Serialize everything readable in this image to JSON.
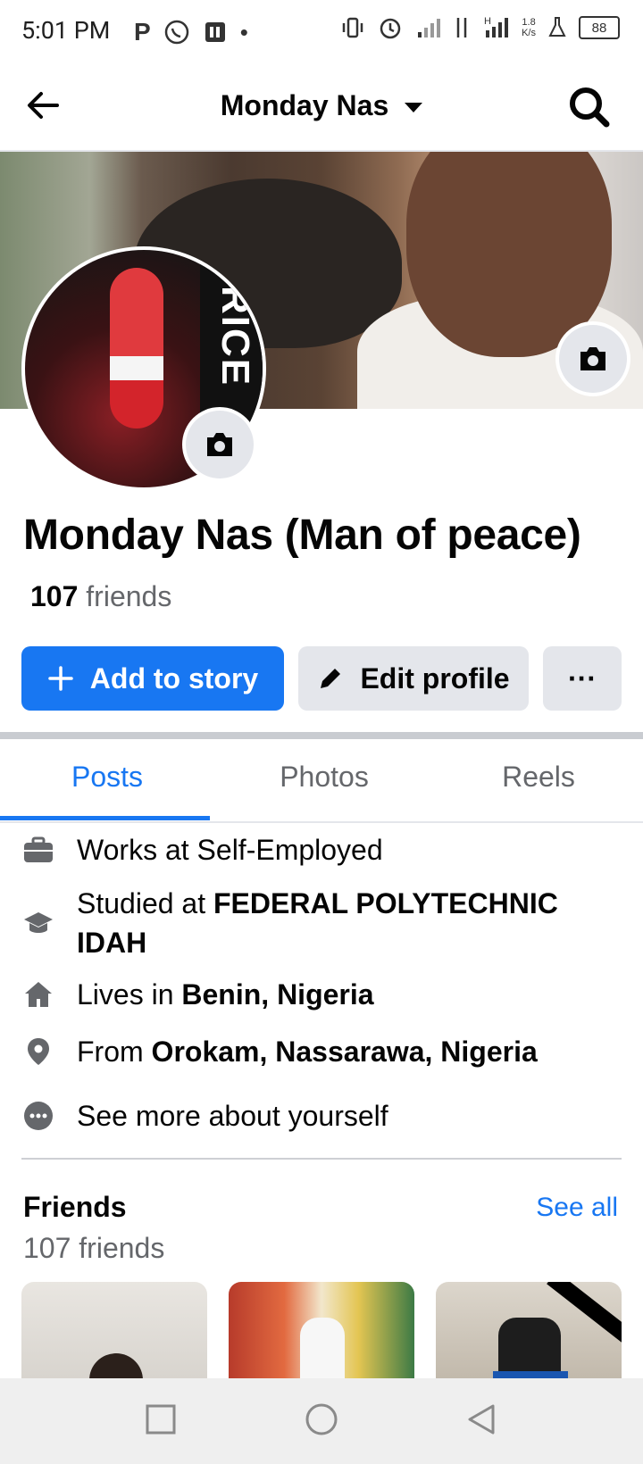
{
  "status_bar": {
    "time": "5:01 PM",
    "battery": "88",
    "net_speed": "1.8\nK/s"
  },
  "header": {
    "title": "Monday Nas"
  },
  "profile": {
    "name": "Monday Nas (Man of peace)",
    "friends_count": "107",
    "friends_word": "friends",
    "avatar_text": "RICE"
  },
  "actions": {
    "add_story": "Add to story",
    "edit_profile": "Edit profile",
    "more": "···"
  },
  "tabs": [
    "Posts",
    "Photos",
    "Reels"
  ],
  "about": {
    "work_prefix": "Works at Self-Employed",
    "study_prefix": "Studied at ",
    "study_place": "FEDERAL POLYTECHNIC IDAH",
    "lives_prefix": "Lives in ",
    "lives_place": "Benin, Nigeria",
    "from_prefix": "From ",
    "from_place": "Orokam, Nassarawa, Nigeria",
    "see_more": "See more about yourself"
  },
  "friends": {
    "title": "Friends",
    "count_text": "107 friends",
    "see_all": "See all"
  },
  "colors": {
    "accent": "#1877f2",
    "button_grey": "#e4e6eb",
    "secondary_text": "#65676b"
  }
}
